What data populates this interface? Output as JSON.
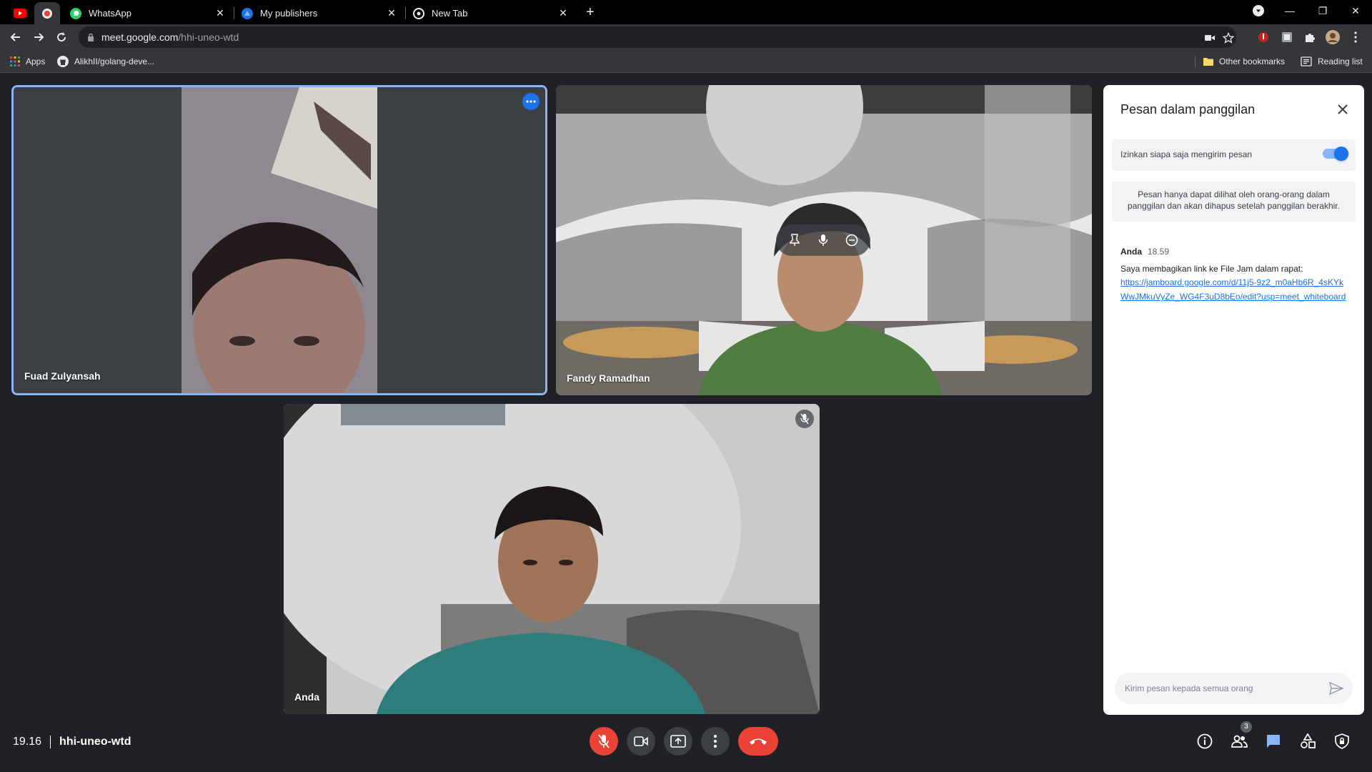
{
  "browser": {
    "tabs": [
      {
        "title": "WhatsApp",
        "icon": "whatsapp-icon",
        "active": false
      },
      {
        "title": "My publishers",
        "icon": "publishers-icon",
        "active": false
      },
      {
        "title": "New Tab",
        "icon": "chrome-icon",
        "active": false
      }
    ],
    "url_host": "meet.google.com",
    "url_path": "/hhi-uneo-wtd",
    "bookmarks": {
      "apps": "Apps",
      "github": "AlikhII/golang-deve...",
      "other": "Other bookmarks",
      "reading_list": "Reading list"
    }
  },
  "participants": [
    {
      "name": "Fuad Zulyansah",
      "highlighted": true
    },
    {
      "name": "Fandy Ramadhan",
      "highlighted": false
    },
    {
      "name": "Anda",
      "highlighted": false,
      "muted": true
    }
  ],
  "chat": {
    "title": "Pesan dalam panggilan",
    "toggle_label": "Izinkan siapa saja mengirim pesan",
    "toggle_on": true,
    "info": "Pesan hanya dapat dilihat oleh orang-orang dalam panggilan dan akan dihapus setelah panggilan berakhir.",
    "messages": [
      {
        "sender": "Anda",
        "time": "18.59",
        "text": "Saya membagikan link ke File Jam dalam rapat:",
        "link": "https://jamboard.google.com/d/11j5-9z2_m0aHb6R_4sKYkWwJMkuVyZe_WG4F3uD8bEo/edit?usp=meet_whiteboard"
      }
    ],
    "input_placeholder": "Kirim pesan kepada semua orang"
  },
  "meeting": {
    "time": "19.16",
    "code": "hhi-uneo-wtd",
    "participant_count": "3"
  },
  "colors": {
    "accent": "#1a73e8",
    "highlight_border": "#8ab4f8",
    "danger": "#ea4335",
    "background": "#202124"
  }
}
